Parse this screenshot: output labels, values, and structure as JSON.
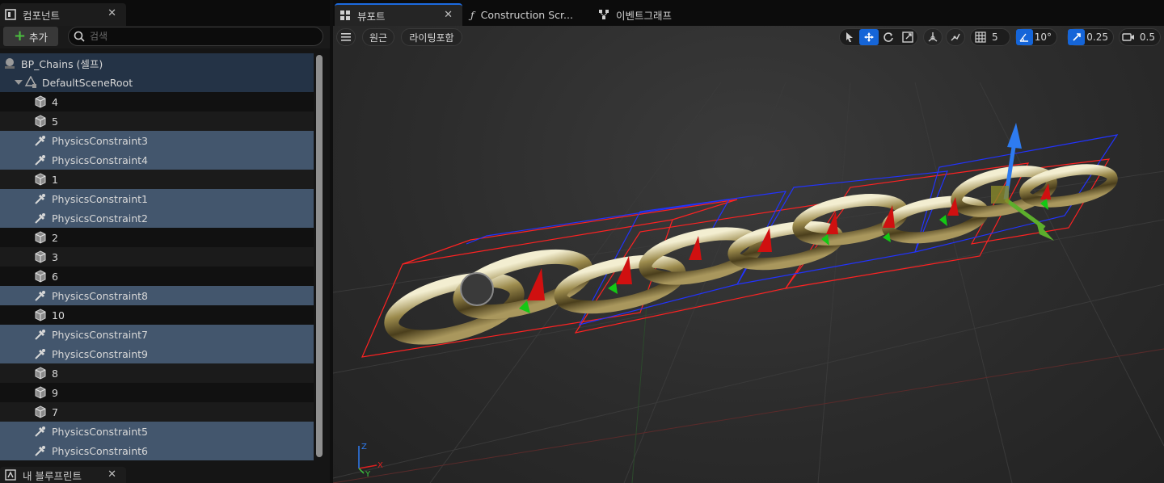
{
  "left_panel": {
    "components_tab": "컴포넌트",
    "add_label": "추가",
    "search_placeholder": "검색",
    "tree": [
      {
        "label": "BP_Chains (셀프)",
        "type": "root",
        "style": "hl"
      },
      {
        "label": "DefaultSceneRoot",
        "type": "scene",
        "style": "hl"
      },
      {
        "label": "4",
        "type": "mesh",
        "style": "dark"
      },
      {
        "label": "5",
        "type": "mesh",
        "style": "alt"
      },
      {
        "label": "PhysicsConstraint3",
        "type": "constraint",
        "style": "sel"
      },
      {
        "label": "PhysicsConstraint4",
        "type": "constraint",
        "style": "sel"
      },
      {
        "label": "1",
        "type": "mesh",
        "style": "alt"
      },
      {
        "label": "PhysicsConstraint1",
        "type": "constraint",
        "style": "sel"
      },
      {
        "label": "PhysicsConstraint2",
        "type": "constraint",
        "style": "sel"
      },
      {
        "label": "2",
        "type": "mesh",
        "style": "dark"
      },
      {
        "label": "3",
        "type": "mesh",
        "style": "alt"
      },
      {
        "label": "6",
        "type": "mesh",
        "style": "dark"
      },
      {
        "label": "PhysicsConstraint8",
        "type": "constraint",
        "style": "sel"
      },
      {
        "label": "10",
        "type": "mesh",
        "style": "dark"
      },
      {
        "label": "PhysicsConstraint7",
        "type": "constraint",
        "style": "sel"
      },
      {
        "label": "PhysicsConstraint9",
        "type": "constraint",
        "style": "sel"
      },
      {
        "label": "8",
        "type": "mesh",
        "style": "alt"
      },
      {
        "label": "9",
        "type": "mesh",
        "style": "dark"
      },
      {
        "label": "7",
        "type": "mesh",
        "style": "alt"
      },
      {
        "label": "PhysicsConstraint5",
        "type": "constraint",
        "style": "sel"
      },
      {
        "label": "PhysicsConstraint6",
        "type": "constraint",
        "style": "sel"
      }
    ],
    "bottom_tab": "내 블루프린트"
  },
  "right_panel": {
    "tabs": [
      {
        "label": "뷰포트",
        "icon": "viewport-grid-icon",
        "active": true
      },
      {
        "label": "Construction Scr...",
        "icon": "function-icon",
        "active": false
      },
      {
        "label": "이벤트그래프",
        "icon": "event-graph-icon",
        "active": false
      }
    ],
    "toolbar": {
      "perspective_label": "원근",
      "lighting_label": "라이팅포함",
      "grid_snap": "5",
      "rotation_snap": "10°",
      "scale_snap": "0.25",
      "camera_speed": "0.5"
    }
  },
  "colors": {
    "accent": "#1565d8",
    "selected_row": "#43566d",
    "add_plus": "#4bbf3f"
  }
}
